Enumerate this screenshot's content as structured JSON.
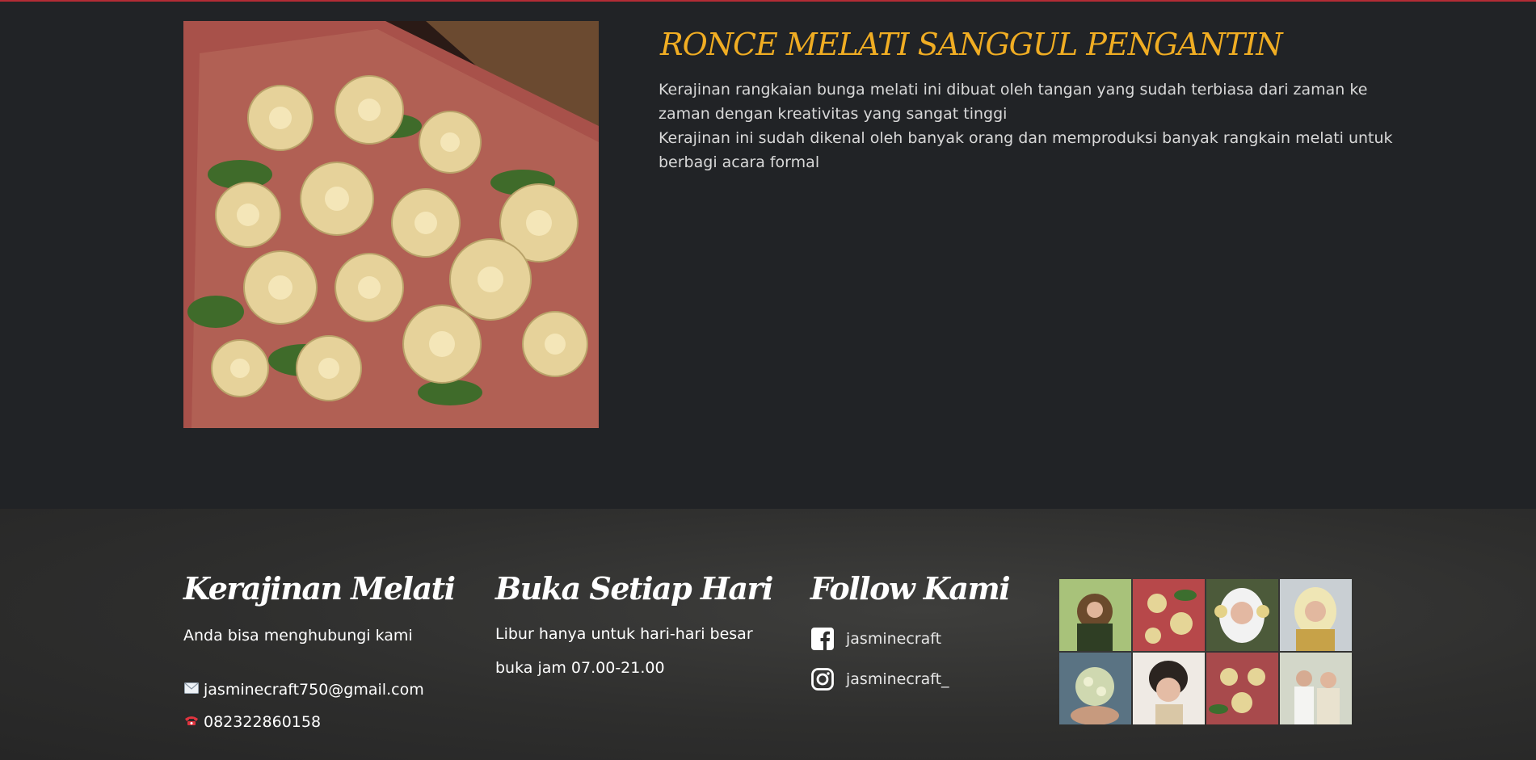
{
  "product": {
    "title": "RONCE MELATI SANGGUL PENGANTIN",
    "description_lines": [
      "Kerajinan rangkaian bunga melati ini dibuat oleh tangan yang sudah terbiasa dari zaman ke",
      "zaman dengan kreativitas yang sangat tinggi",
      "Kerajinan ini sudah dikenal oleh banyak orang dan memproduksi banyak rangkain melati untuk",
      "berbagi acara formal"
    ]
  },
  "footer": {
    "contact": {
      "title": "Kerajinan Melati",
      "subtitle": "Anda bisa menghubungi kami",
      "email": "jasminecraft750@gmail.com",
      "phone": "082322860158",
      "email_icon": "envelope-icon",
      "phone_icon": "telephone-icon"
    },
    "hours": {
      "title": "Buka Setiap Hari",
      "lines": [
        "Libur hanya untuk hari-hari besar",
        "buka jam 07.00-21.00"
      ]
    },
    "follow": {
      "title": "Follow Kami",
      "facebook": "jasminecraft",
      "instagram": "jasminecraft_",
      "facebook_icon": "facebook-icon",
      "instagram_icon": "instagram-icon"
    }
  },
  "colors": {
    "accent": "#f0ad23",
    "top_border": "#b32c35",
    "background": "#212326",
    "footer_bg": "#2e2e2d"
  }
}
